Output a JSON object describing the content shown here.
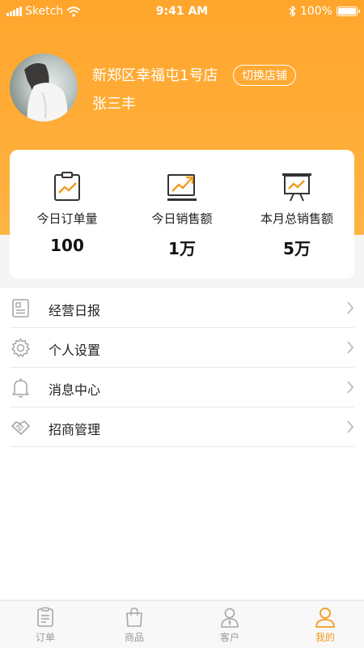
{
  "status_bar": {
    "carrier": "Sketch",
    "time": "9:41 AM",
    "battery": "100%",
    "battery_level": 1.0
  },
  "profile": {
    "store_name": "新郑区幸福屯1号店",
    "switch_label": "切换店铺",
    "user_name": "张三丰"
  },
  "stats": [
    {
      "icon": "clipboard-chart-icon",
      "label": "今日订单量",
      "value": "100"
    },
    {
      "icon": "monitor-trend-icon",
      "label": "今日销售额",
      "value": "1万"
    },
    {
      "icon": "presentation-board-icon",
      "label": "本月总销售额",
      "value": "5万"
    }
  ],
  "menu": [
    {
      "icon": "report-icon",
      "label": "经营日报"
    },
    {
      "icon": "gear-icon",
      "label": "个人设置"
    },
    {
      "icon": "bell-icon",
      "label": "消息中心"
    },
    {
      "icon": "handshake-icon",
      "label": "招商管理"
    }
  ],
  "tabs": [
    {
      "icon": "order-list-icon",
      "label": "订单",
      "active": false
    },
    {
      "icon": "shopping-bag-icon",
      "label": "商品",
      "active": false
    },
    {
      "icon": "customer-icon",
      "label": "客户",
      "active": false
    },
    {
      "icon": "user-icon",
      "label": "我的",
      "active": true
    }
  ],
  "colors": {
    "accent": "#f39a1e",
    "header": "#ffa52c",
    "icon_gray": "#a6a6a6",
    "text": "#222222"
  }
}
